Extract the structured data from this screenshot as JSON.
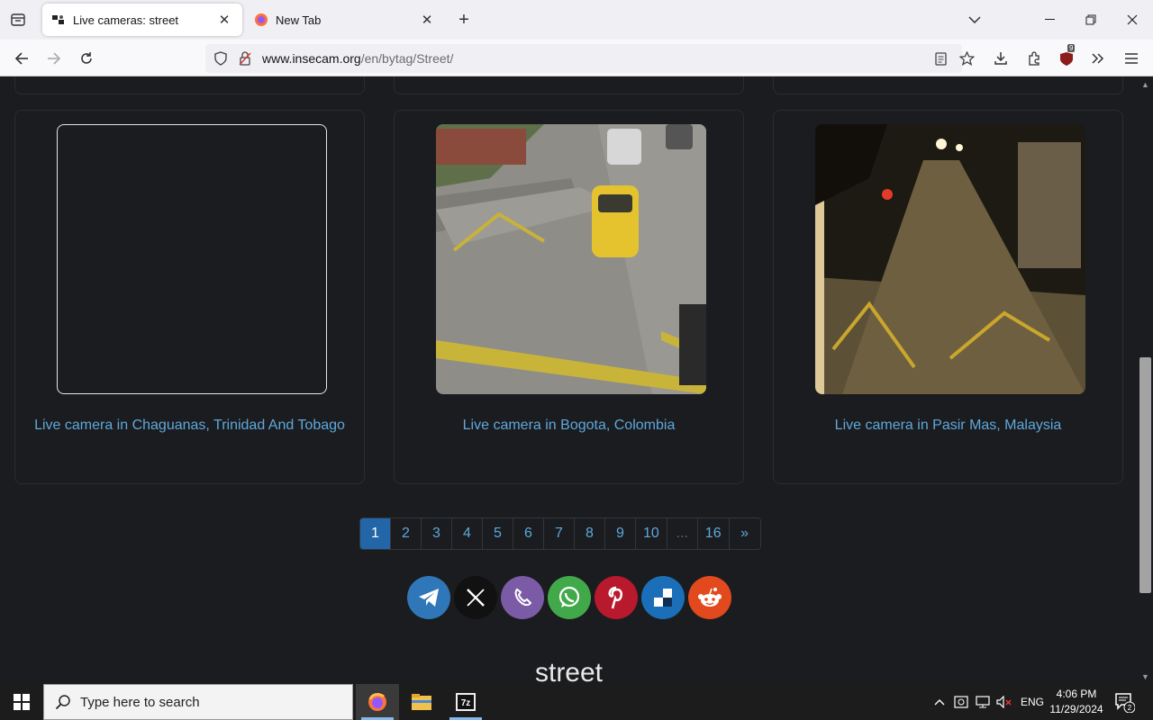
{
  "browser": {
    "tabs": [
      {
        "title": "Live cameras: street",
        "active": true
      },
      {
        "title": "New Tab",
        "active": false
      }
    ],
    "url_host": "www.insecam.org",
    "url_path": "/en/bytag/Street/",
    "ublock_count": "9"
  },
  "cameras": [
    {
      "label": "Live camera in Chaguanas, Trinidad And Tobago",
      "image": "blank"
    },
    {
      "label": "Live camera in Bogota, Colombia",
      "image": "day-street"
    },
    {
      "label": "Live camera in Pasir Mas, Malaysia",
      "image": "night-street"
    }
  ],
  "pagination": {
    "pages": [
      "1",
      "2",
      "3",
      "4",
      "5",
      "6",
      "7",
      "8",
      "9",
      "10",
      "...",
      "16",
      "»"
    ],
    "current": "1"
  },
  "share": [
    {
      "name": "telegram",
      "color": "#2f77b8"
    },
    {
      "name": "x",
      "color": "#111111"
    },
    {
      "name": "viber",
      "color": "#7b5aa6"
    },
    {
      "name": "whatsapp",
      "color": "#41a94a"
    },
    {
      "name": "pinterest",
      "color": "#b8192d"
    },
    {
      "name": "delicious",
      "color": "#1b6fb8"
    },
    {
      "name": "reddit",
      "color": "#e24a1d"
    }
  ],
  "tag_heading": "street",
  "taskbar": {
    "search_placeholder": "Type here to search",
    "language": "ENG",
    "time": "4:06 PM",
    "date": "11/29/2024",
    "notification_count": "2"
  }
}
